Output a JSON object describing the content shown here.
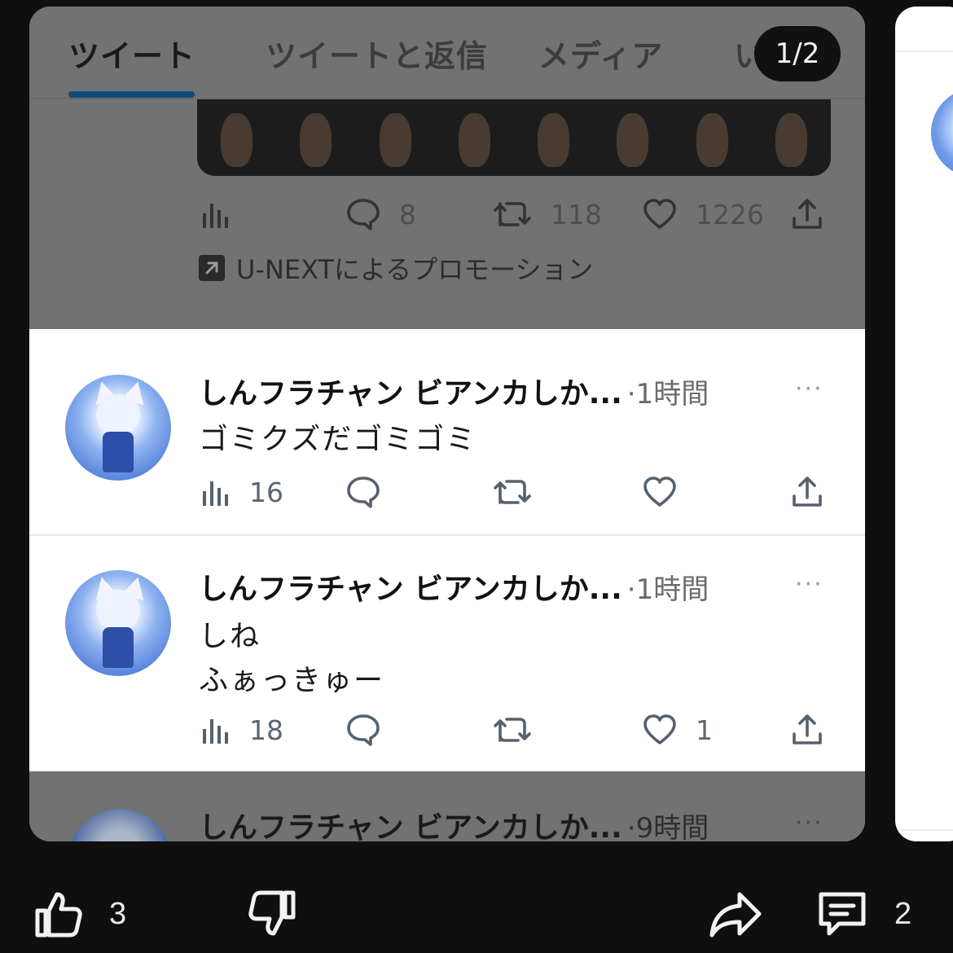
{
  "tabs": [
    "ツイート",
    "ツイートと返信",
    "メディア",
    "い"
  ],
  "carousel": {
    "counter": "1/2"
  },
  "promo_tweet": {
    "reply_count": "8",
    "retweet_count": "118",
    "like_count": "1226",
    "promotion_text": "U-NEXTによるプロモーション"
  },
  "tweets": [
    {
      "name": "しんフラチャン ビアンカしか...",
      "time": "·1時間",
      "text_lines": [
        "ゴミクズだゴミゴミ"
      ],
      "views": "16",
      "likes": ""
    },
    {
      "name": "しんフラチャン ビアンカしか...",
      "time": "·1時間",
      "text_lines": [
        "しね",
        "ふぁっきゅー"
      ],
      "views": "18",
      "likes": "1"
    }
  ],
  "partial_tweet": {
    "name": "しんフラチャン ビアンカしか...",
    "time": "·9時間"
  },
  "more_label": "···",
  "bottom_bar": {
    "like_count": "3",
    "comment_count": "2"
  },
  "colors": {
    "background": "#0f0f0f",
    "dim_overlay": "#727272",
    "tab_underline": "#104a7a"
  }
}
